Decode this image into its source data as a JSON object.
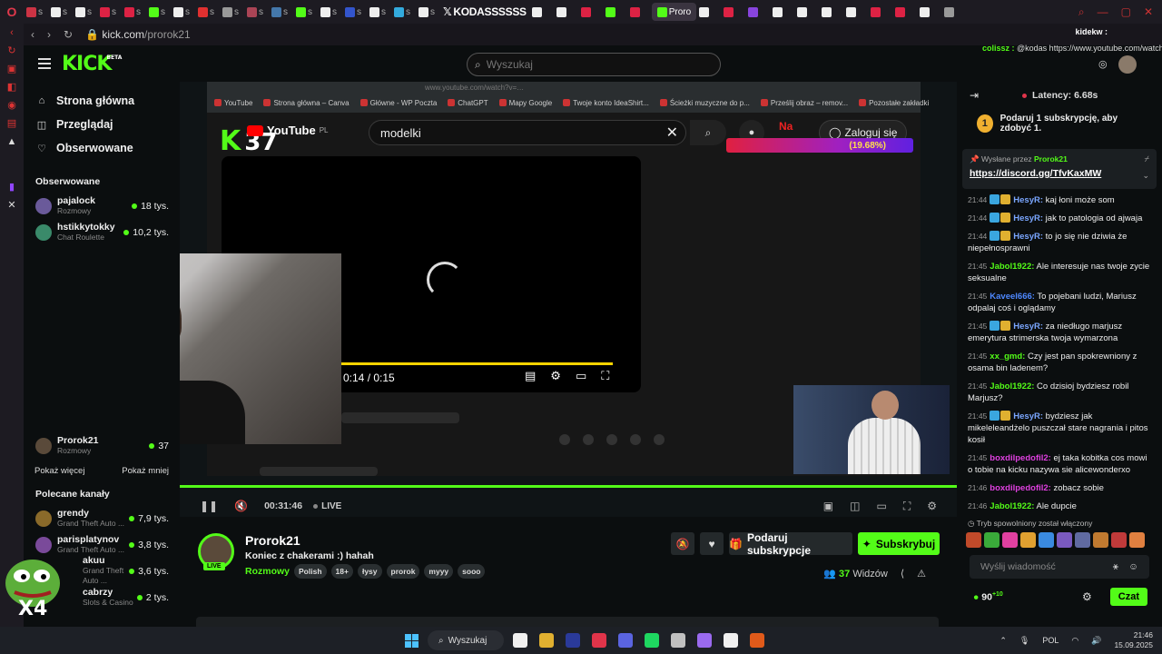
{
  "browser": {
    "tabs": [
      {
        "label": "",
        "color": "#cc3344"
      },
      {
        "label": "",
        "color": "#eeeeee"
      },
      {
        "label": "",
        "color": "#eeeeee"
      },
      {
        "label": "",
        "color": "#dd2244"
      },
      {
        "label": "",
        "color": "#dd2244"
      },
      {
        "label": "",
        "color": "#53fc18"
      },
      {
        "label": "",
        "color": "#eeeeee"
      },
      {
        "label": "",
        "color": "#e03030"
      },
      {
        "label": "",
        "color": "#999999"
      },
      {
        "label": "",
        "color": "#aa4455"
      },
      {
        "label": "",
        "color": "#4477aa"
      },
      {
        "label": "",
        "color": "#53fc18"
      },
      {
        "label": "",
        "color": "#eeeeee"
      },
      {
        "label": "",
        "color": "#3355cc"
      },
      {
        "label": "",
        "color": "#eeeeee"
      },
      {
        "label": "",
        "color": "#33aadd"
      },
      {
        "label": "",
        "color": "#eeeeee"
      }
    ],
    "kodas_tab": "KODASSSSSS",
    "active_tab": "Proro",
    "url_host": "kick.com",
    "url_path": "/prorok21"
  },
  "kick": {
    "logo": "KICK",
    "logo_beta": "BETA",
    "search_placeholder": "Wyszukaj",
    "nav": [
      {
        "label": "Strona główna",
        "icon": "home-icon"
      },
      {
        "label": "Przeglądaj",
        "icon": "browse-icon"
      },
      {
        "label": "Obserwowane",
        "icon": "heart-icon"
      }
    ],
    "followed_title": "Obserwowane",
    "followed": [
      {
        "name": "pajalock",
        "category": "Rozmowy",
        "viewers": "18 tys.",
        "color": "#6a5a9a"
      },
      {
        "name": "hstikkytokky",
        "category": "Chat Roulette",
        "viewers": "10,2 tys.",
        "color": "#3a8a6a"
      }
    ],
    "followed_current": {
      "name": "Prorok21",
      "category": "Rozmowy",
      "viewers": "37",
      "color": "#5a4a3a"
    },
    "show_more": "Pokaż więcej",
    "show_less": "Pokaż mniej",
    "recommended_title": "Polecane kanały",
    "recommended": [
      {
        "name": "grendy",
        "category": "Grand Theft Auto ...",
        "viewers": "7,9 tys.",
        "color": "#8a6a2a"
      },
      {
        "name": "parisplatynov",
        "category": "Grand Theft Auto ...",
        "viewers": "3,8 tys.",
        "color": "#7a4a9a"
      },
      {
        "name": "akuu",
        "category": "Grand Theft Auto ...",
        "viewers": "3,6 tys.",
        "color": "#aa7a5a"
      },
      {
        "name": "cabrzy",
        "category": "Slots & Casino",
        "viewers": "2 tys.",
        "color": "#5a5a5a"
      }
    ],
    "pepe_label": "X4"
  },
  "player": {
    "yt_url": "www.youtube.com/watch?v=…",
    "bookmarks": [
      "YouTube",
      "Strona główna – Canva",
      "Główne - WP Poczta",
      "ChatGPT",
      "Mapy Google",
      "Twoje konto IdeaShirt...",
      "Ścieżki muzyczne do p...",
      "Prześlij obraz – remov...",
      "Pozostałe zakładki"
    ],
    "yt_logo": "YouTube",
    "yt_region": "PL",
    "k_badge": "K",
    "k_count": "37",
    "yt_search": "modelki",
    "yt_login": "Zaloguj się",
    "yt_red_text": "Na",
    "goal_percent": "(19.68%)",
    "yt_time": "0:14 / 0:15",
    "yt_progress": 0.93,
    "elapsed": "00:31:46",
    "live": "LIVE"
  },
  "stream": {
    "name": "Prorok21",
    "title": "Koniec z chakerami  :) hahah",
    "category": "Rozmowy",
    "tags": [
      "Polish",
      "18+",
      "łysy",
      "prorok",
      "myyy",
      "sooo"
    ],
    "gift_label": "Podaruj subskrypcje",
    "subscribe_label": "Subskrybuj",
    "viewers": "37",
    "viewers_label": "Widzów",
    "live_badge": "LIVE"
  },
  "chat": {
    "latency": "Latency: 6.68s",
    "sub_banner_count": "1",
    "sub_banner": "Podaruj 1 subskrypcję, aby zdobyć 1.",
    "pinned_by_label": "Wysłane przez",
    "pinned_by": "Prorok21",
    "pinned_link": "https://discord.gg/TfvKaxMW",
    "top_user": "kidekw :",
    "top_msg_user": "colissz :",
    "top_msg": "@kodas https://www.youtube.com/watch?v=E1d6NzKJf68",
    "messages": [
      {
        "time": "21:44",
        "user": "HesyR:",
        "color": "#7aa6ff",
        "badges": true,
        "text": "kaj łoni może som"
      },
      {
        "time": "21:44",
        "user": "HesyR:",
        "color": "#7aa6ff",
        "badges": true,
        "text": "jak to patologia od ajwaja"
      },
      {
        "time": "21:44",
        "user": "HesyR:",
        "color": "#7aa6ff",
        "badges": true,
        "text": "to jo się nie dziwia że niepełnosprawni"
      },
      {
        "time": "21:45",
        "user": "Jabol1922:",
        "color": "#53fc18",
        "badges": false,
        "text": "Ale interesuje nas twoje zycie seksualne"
      },
      {
        "time": "21:45",
        "user": "Kaveel666:",
        "color": "#4e88ff",
        "badges": false,
        "text": "To pojebani ludzi, Mariusz odpalaj coś i oglądamy"
      },
      {
        "time": "21:45",
        "user": "HesyR:",
        "color": "#7aa6ff",
        "badges": true,
        "text": "za niedługo marjusz emerytura strimerska twoja wymarzona"
      },
      {
        "time": "21:45",
        "user": "xx_gmd:",
        "color": "#53fc18",
        "badges": false,
        "text": "Czy jest pan spokrewniony z osama bin ladenem?"
      },
      {
        "time": "21:45",
        "user": "Jabol1922:",
        "color": "#53fc18",
        "badges": false,
        "text": "Co dzisioj bydziesz robil Marjusz?"
      },
      {
        "time": "21:45",
        "user": "HesyR:",
        "color": "#7aa6ff",
        "badges": true,
        "text": "bydziesz jak mikeleleandżelo puszczał stare nagrania i pitos kosił"
      },
      {
        "time": "21:45",
        "user": "boxdilpedofil2:",
        "color": "#e040e0",
        "badges": false,
        "text": "ej taka kobitka cos mowi o tobie na kicku nazywa sie alicewonderxo"
      },
      {
        "time": "21:46",
        "user": "boxdilpedofil2:",
        "color": "#e040e0",
        "badges": false,
        "text": "zobacz sobie"
      },
      {
        "time": "21:46",
        "user": "Jabol1922:",
        "color": "#53fc18",
        "badges": false,
        "text": "Ale dupcie"
      }
    ],
    "slow_mode": "Tryb spowolniony został włączony",
    "emote_colors": [
      "#c04a2a",
      "#3aaa3a",
      "#e040a0",
      "#e0a030",
      "#3a8adf",
      "#7a5abf",
      "#606aa0",
      "#c07a30",
      "#c03a3a",
      "#e08040"
    ],
    "input_placeholder": "Wyślij wiadomość",
    "points": "90",
    "points_plus": "+10",
    "send_label": "Czat"
  },
  "taskbar": {
    "search": "Wyszukaj",
    "lang": "POL",
    "time": "21:46",
    "date": "15.09.2025",
    "apps": [
      "#f0f0f0",
      "#e0b030",
      "#2a3a9a",
      "#e0344a",
      "#5a64e0",
      "#1ed760",
      "#c0c0c0",
      "#9a6aef",
      "#f0f0f0",
      "#e05a1a"
    ]
  }
}
